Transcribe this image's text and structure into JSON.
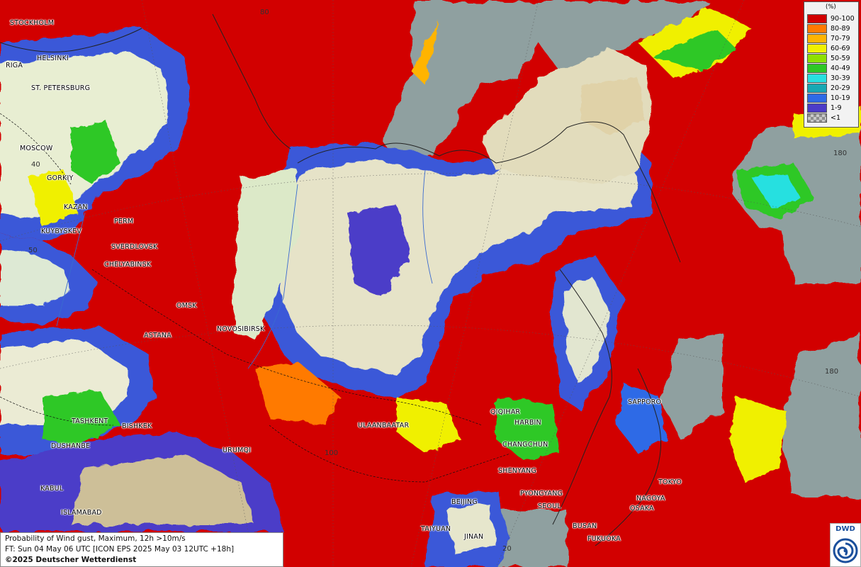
{
  "legend": {
    "unit": "(%)",
    "items": [
      {
        "label": "90-100",
        "color": "#d20000"
      },
      {
        "label": "80-89",
        "color": "#ff7a00"
      },
      {
        "label": "70-79",
        "color": "#ffb400"
      },
      {
        "label": "60-69",
        "color": "#f0f000"
      },
      {
        "label": "50-59",
        "color": "#8ee000"
      },
      {
        "label": "40-49",
        "color": "#2ec826"
      },
      {
        "label": "30-39",
        "color": "#28e0e0"
      },
      {
        "label": "20-29",
        "color": "#18a8b4"
      },
      {
        "label": "10-19",
        "color": "#2e6ae6"
      },
      {
        "label": "1-9",
        "color": "#4c3cc8"
      },
      {
        "label": "<1",
        "color": "#a8a8a8"
      }
    ]
  },
  "cities": [
    {
      "name": "STOCKHOLM"
    },
    {
      "name": "HELSINKI"
    },
    {
      "name": "RIGA"
    },
    {
      "name": "ST. PETERSBURG"
    },
    {
      "name": "MOSCOW"
    },
    {
      "name": "GORKIY"
    },
    {
      "name": "KAZAN"
    },
    {
      "name": "KUYBYSKEV"
    },
    {
      "name": "PERM"
    },
    {
      "name": "SVERDLOVSK"
    },
    {
      "name": "CHELYABINSK"
    },
    {
      "name": "OMSK"
    },
    {
      "name": "ASTANA"
    },
    {
      "name": "NOVOSIBIRSK"
    },
    {
      "name": "TASHKENT"
    },
    {
      "name": "BISHKEK"
    },
    {
      "name": "DUSHANBE"
    },
    {
      "name": "URUMQI"
    },
    {
      "name": "KABUL"
    },
    {
      "name": "ISLAMABAD"
    },
    {
      "name": "ULAANBAATAR"
    },
    {
      "name": "QIQIHAR"
    },
    {
      "name": "HARBIN"
    },
    {
      "name": "CHANGCHUN"
    },
    {
      "name": "SHENYANG"
    },
    {
      "name": "PYONGYANG"
    },
    {
      "name": "SEOUL"
    },
    {
      "name": "BEIJING"
    },
    {
      "name": "TAIYUAN"
    },
    {
      "name": "JINAN"
    },
    {
      "name": "BUSAN"
    },
    {
      "name": "FUKUOKA"
    },
    {
      "name": "OSAKA"
    },
    {
      "name": "NAGOYA"
    },
    {
      "name": "TOKYO"
    },
    {
      "name": "SAPPORO"
    }
  ],
  "grid_labels": [
    "40",
    "50",
    "100",
    "180",
    "180",
    "20",
    "80"
  ],
  "info": {
    "line1": "Probability of Wind gust, Maximum, 12h >10m/s",
    "line2": "FT: Sun 04 May 06 UTC [ICON EPS 2025 May 03 12UTC +18h]",
    "line3": "©2025 Deutscher Wetterdienst"
  },
  "logo": {
    "text": "DWD"
  }
}
